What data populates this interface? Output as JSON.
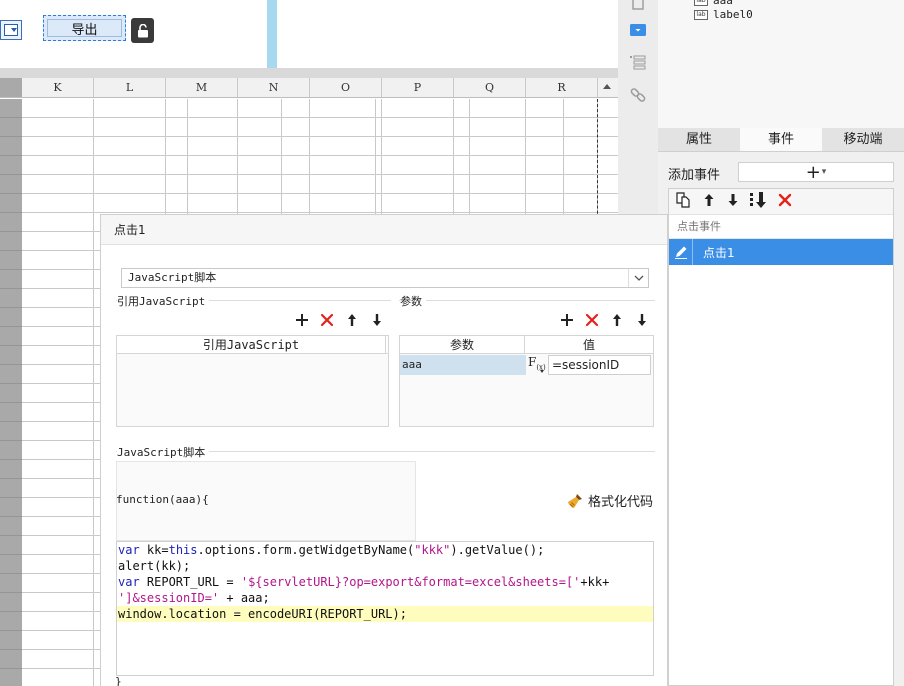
{
  "canvas": {
    "export_button_label": "导出"
  },
  "sheet": {
    "columns": [
      "K",
      "L",
      "M",
      "N",
      "O",
      "P",
      "Q",
      "R"
    ]
  },
  "tree": {
    "items": [
      {
        "icon": "lab",
        "label": "aaa"
      },
      {
        "icon": "lab",
        "label": "label0"
      }
    ]
  },
  "tabs": [
    {
      "label": "属性",
      "active": false
    },
    {
      "label": "事件",
      "active": true
    },
    {
      "label": "移动端",
      "active": false
    }
  ],
  "events": {
    "add_event_label": "添加事件",
    "group_label": "点击事件",
    "items": [
      {
        "label": "点击1",
        "selected": true
      }
    ]
  },
  "dialog": {
    "title": "点击1",
    "type_value": "JavaScript脚本",
    "ref_js_section": "引用JavaScript",
    "ref_js_column": "引用JavaScript",
    "params_section": "参数",
    "params_columns": [
      "参数",
      "值"
    ],
    "params_rows": [
      {
        "name": "aaa",
        "value": "=sessionID"
      }
    ],
    "script_section": "JavaScript脚本",
    "function_header": "function(aaa){",
    "format_code_label": "格式化代码",
    "function_footer": "}",
    "code_lines": [
      "var kk=this.options.form.getWidgetByName(\"kkk\").getValue();",
      "alert(kk);",
      "var REPORT_URL = '${servletURL}?op=export&format=excel&sheets=['+kk+",
      "']&sessionID=' + aaa;",
      "window.location = encodeURI(REPORT_URL);"
    ]
  },
  "colors": {
    "selection_blue": "#3a8ee6",
    "delete_red": "#e2231a",
    "keyword_blue": "#1d23b8",
    "string_magenta": "#b1168a",
    "highlight_line": "#fffdbd"
  }
}
